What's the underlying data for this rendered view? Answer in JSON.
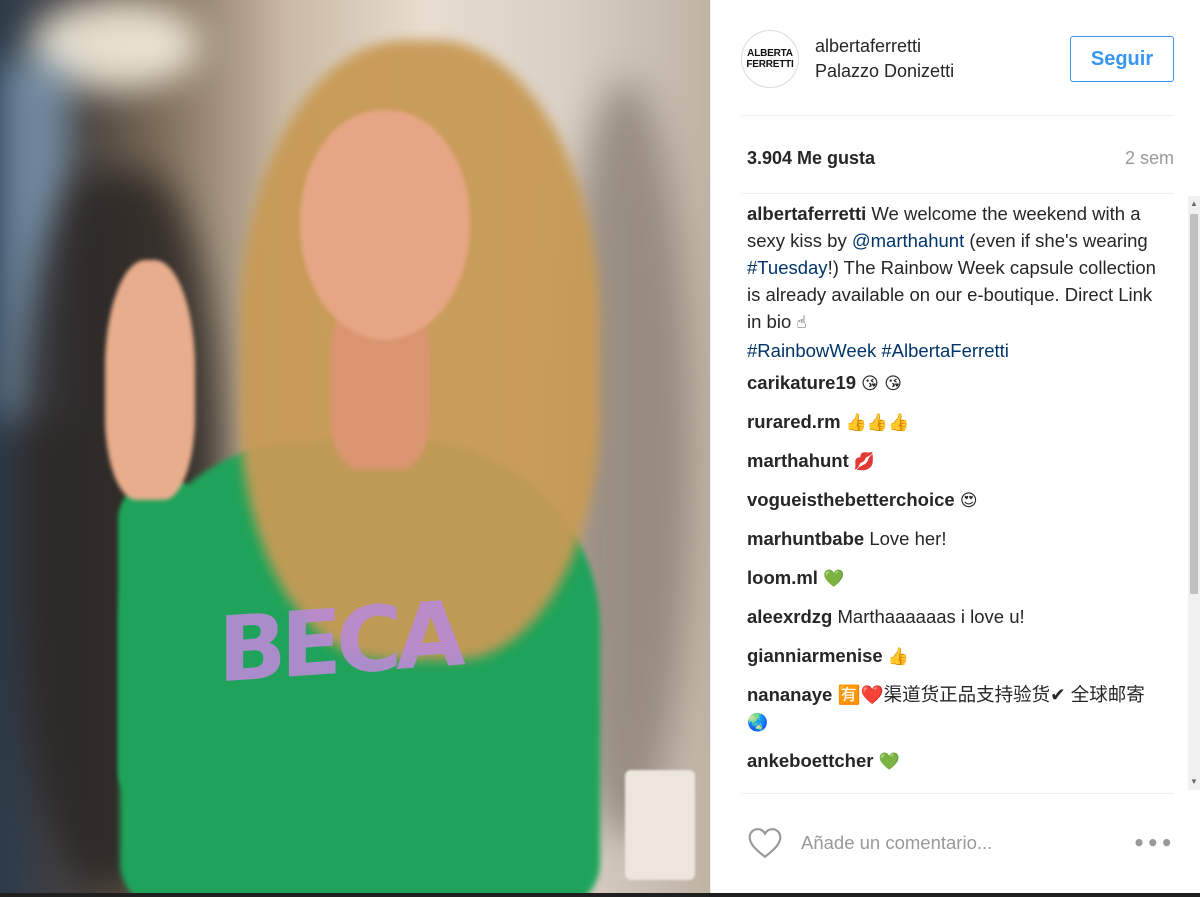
{
  "post": {
    "header": {
      "avatar_text_line1": "ALBERTA",
      "avatar_text_line2": "FERRETTI",
      "username": "albertaferretti",
      "location": "Palazzo Donizetti",
      "follow_label": "Seguir"
    },
    "photo": {
      "sweater_lettering": "ВЕСА"
    },
    "stats": {
      "likes": "3.904 Me gusta",
      "time_ago": "2 sem"
    },
    "caption": {
      "author": "albertaferretti",
      "text_part1": " We welcome the weekend with a sexy kiss by ",
      "mention": "@marthahunt",
      "text_part2": " (even if she's wearing ",
      "hashtag1": "#Tuesday",
      "text_part3": "!) The Rainbow Week capsule collection is already available on our e-boutique. Direct Link in bio ",
      "emoji": "☝",
      "hashtag2": "#RainbowWeek",
      "hashtag3": "#AlbertaFerretti"
    },
    "comments": [
      {
        "author": "carikature19",
        "text": "",
        "emoji": "😘 😘"
      },
      {
        "author": "rurared.rm",
        "text": "",
        "emoji": "👍👍👍"
      },
      {
        "author": "marthahunt",
        "text": "",
        "emoji": "💋"
      },
      {
        "author": "vogueisthebetterchoice",
        "text": "",
        "emoji": "😍"
      },
      {
        "author": "marhuntbabe",
        "text": "Love her!",
        "emoji": ""
      },
      {
        "author": "loom.ml",
        "text": "",
        "emoji": "💚"
      },
      {
        "author": "aleexrdzg",
        "text": "Marthaaaaaas i love u!",
        "emoji": ""
      },
      {
        "author": "gianniarmenise",
        "text": "",
        "emoji": "👍"
      },
      {
        "author": "nananaye",
        "text": "🈶❤️渠道货正品支持验货✔ 全球邮寄",
        "emoji": "🌏"
      },
      {
        "author": "ankeboettcher",
        "text": "",
        "emoji": "💚"
      }
    ],
    "footer": {
      "comment_placeholder": "Añade un comentario...",
      "more_label": "•••"
    },
    "colors": {
      "link": "#003569",
      "follow_button": "#3897f0",
      "sweater": "#1fa35a"
    },
    "icons": {
      "like": "heart-icon",
      "more": "more-options-icon"
    }
  }
}
